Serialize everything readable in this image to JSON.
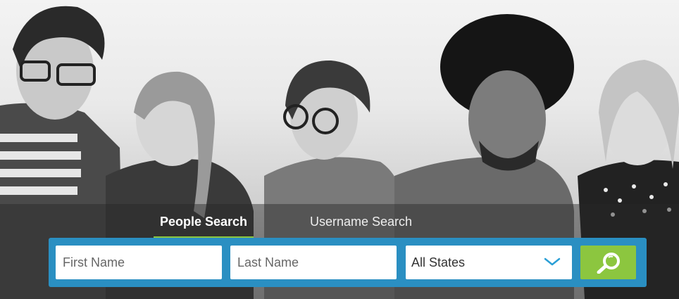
{
  "tabs": {
    "people": "People Search",
    "username": "Username Search"
  },
  "form": {
    "first_name_placeholder": "First Name",
    "last_name_placeholder": "Last Name",
    "state_value": "All States"
  },
  "colors": {
    "bar": "#2a8fc2",
    "accent_green": "#8cc63f",
    "chevron": "#2a9fd6"
  },
  "icons": {
    "search": "search-icon",
    "dropdown": "chevron-down-icon"
  }
}
